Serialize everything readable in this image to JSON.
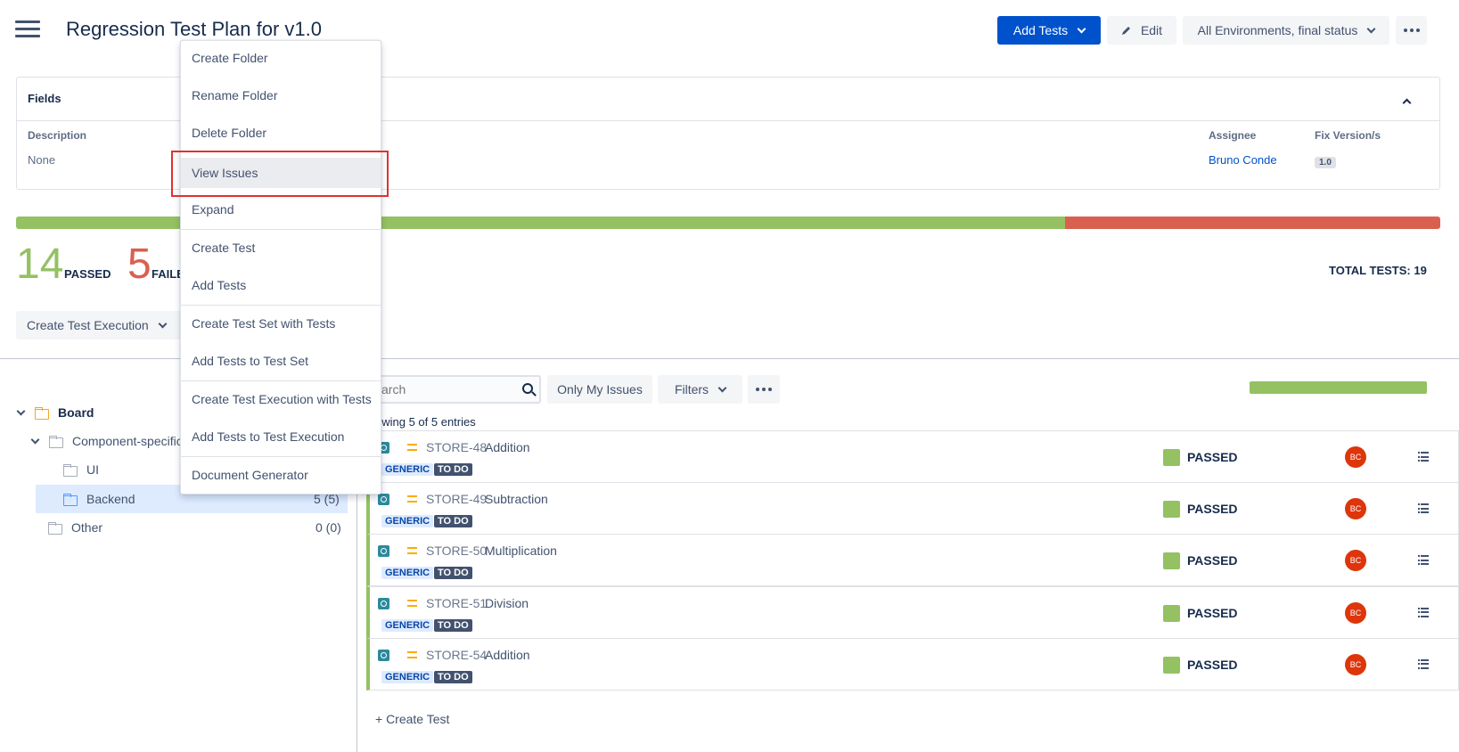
{
  "header": {
    "title": "Regression Test Plan for v1.0",
    "add_tests_label": "Add Tests",
    "edit_label": "Edit",
    "env_label": "All Environments, final status"
  },
  "fields": {
    "title": "Fields",
    "description_label": "Description",
    "description_value": "None",
    "assignee_label": "Assignee",
    "assignee_value": "Bruno Conde",
    "fix_version_label": "Fix Version/s",
    "fix_version_value": "1.0"
  },
  "progress": {
    "passed": 14,
    "failed": 5,
    "colors": {
      "passed": "#94c162",
      "failed": "#d9604f"
    }
  },
  "stats": {
    "passed_count": "14",
    "passed_label": "PASSED",
    "failed_count": "5",
    "failed_label": "FAILE",
    "total_label": "TOTAL TESTS: 19"
  },
  "create_execution_label": "Create Test Execution",
  "tree": {
    "board": "Board",
    "component": "Component-specific",
    "ui": "UI",
    "backend": "Backend",
    "backend_count": "5 (5)",
    "other": "Other",
    "other_count": "0 (0)"
  },
  "toolbar": {
    "search_placeholder": "arch",
    "only_my_issues": "Only My Issues",
    "filters": "Filters",
    "entries": "owing 5 of 5 entries"
  },
  "tests": [
    {
      "key": "STORE-48",
      "summary": "Addition",
      "label": "GENERIC",
      "status_todo": "TO DO",
      "result": "PASSED",
      "avatar": "BC"
    },
    {
      "key": "STORE-49",
      "summary": "Subtraction",
      "label": "GENERIC",
      "status_todo": "TO DO",
      "result": "PASSED",
      "avatar": "BC"
    },
    {
      "key": "STORE-50",
      "summary": "Multiplication",
      "label": "GENERIC",
      "status_todo": "TO DO",
      "result": "PASSED",
      "avatar": "BC"
    },
    {
      "key": "STORE-51",
      "summary": "Division",
      "label": "GENERIC",
      "status_todo": "TO DO",
      "result": "PASSED",
      "avatar": "BC"
    },
    {
      "key": "STORE-54",
      "summary": "Addition",
      "label": "GENERIC",
      "status_todo": "TO DO",
      "result": "PASSED",
      "avatar": "BC"
    }
  ],
  "create_test_link": "+ Create Test",
  "menu": {
    "items": [
      "Create Folder",
      "Rename Folder",
      "Delete Folder",
      "View Issues",
      "Expand",
      "Create Test",
      "Add Tests",
      "Create Test Set with Tests",
      "Add Tests to Test Set",
      "Create Test Execution with Tests",
      "Add Tests to Test Execution",
      "Document Generator"
    ]
  }
}
